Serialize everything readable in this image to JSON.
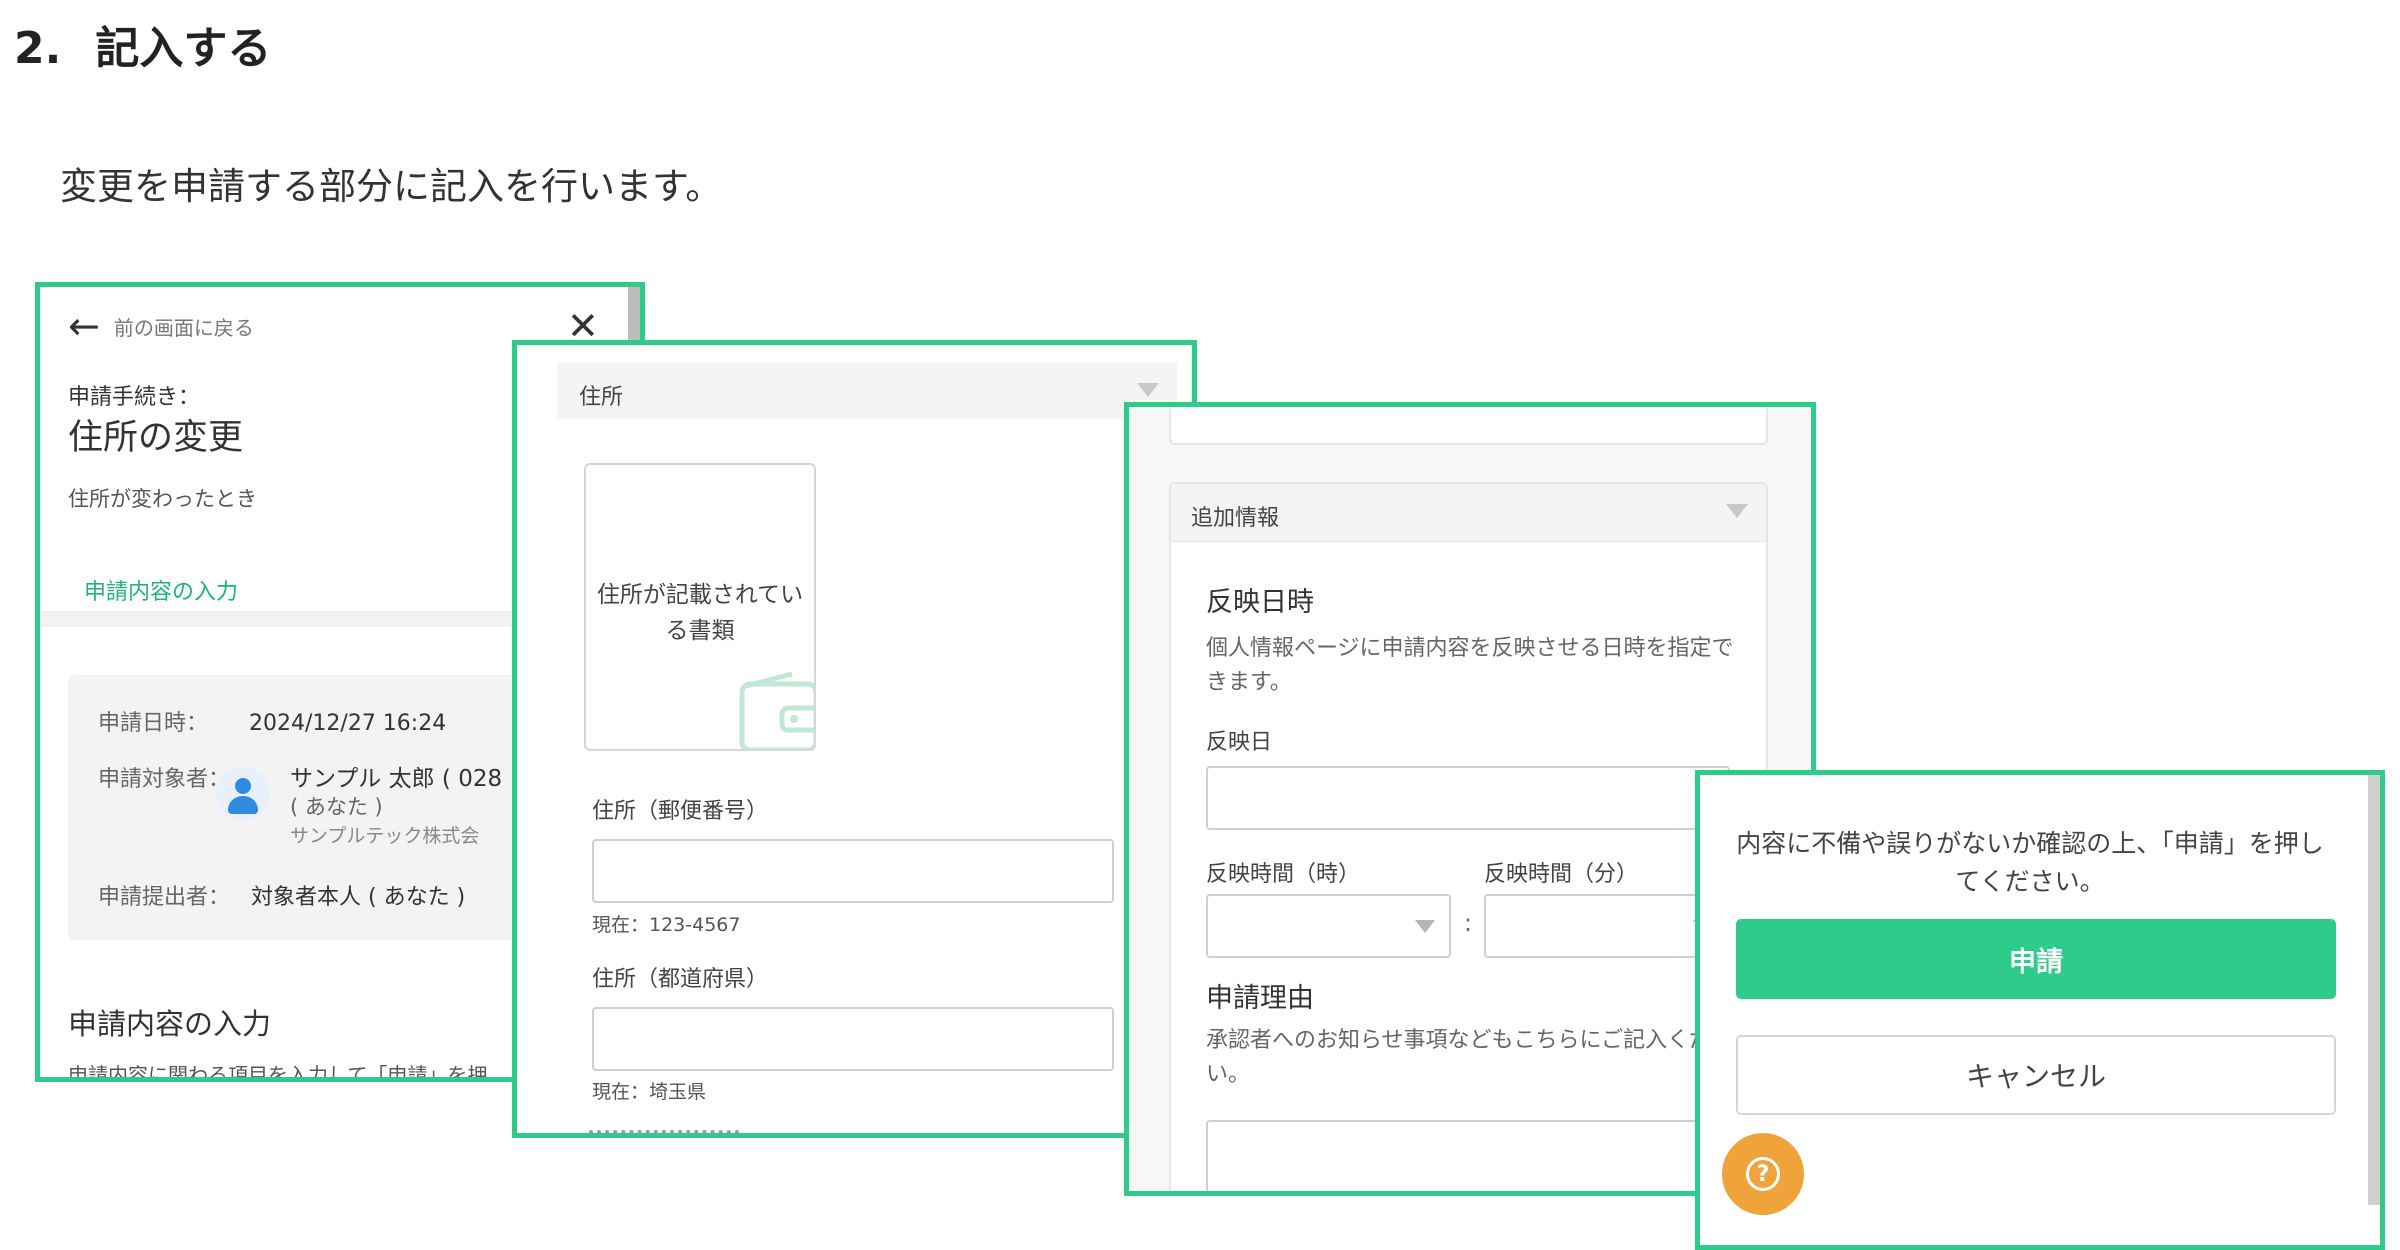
{
  "page": {
    "heading_number": "2.",
    "heading": "記入する",
    "intro": "変更を申請する部分に記入を行います。"
  },
  "panel1": {
    "back_label": "前の画面に戻る",
    "close_glyph": "✕",
    "procedure_label": "申請手続き：",
    "procedure_title": "住所の変更",
    "procedure_desc": "住所が変わったとき",
    "tab_label": "申請内容の入力",
    "info": {
      "date_label": "申請日時：",
      "date_value": "2024/12/27 16:24",
      "target_label": "申請対象者：",
      "target_name": "サンプル 太郎 ( 028",
      "target_you": "( あなた )",
      "target_company": "サンプルテック株式会",
      "submitter_label": "申請提出者：",
      "submitter_value": "対象者本人 ( あなた )"
    },
    "section_title": "申請内容の入力",
    "section_desc": "申請内容に関わる項目を入力して「申請」を押"
  },
  "panel2": {
    "header": "住所",
    "document_label_line1": "住所が記載されてい",
    "document_label_line2": "る書類",
    "postal_label": "住所（郵便番号）",
    "postal_value": "",
    "postal_current": "現在：123-4567",
    "prefecture_label": "住所（都道府県）",
    "prefecture_value": "",
    "prefecture_current": "現在：埼玉県"
  },
  "panel3": {
    "header": "追加情報",
    "reflect_title": "反映日時",
    "reflect_desc": "個人情報ページに申請内容を反映させる日時を指定できます。",
    "reflect_date_label": "反映日",
    "reflect_date_value": "",
    "reflect_hour_label": "反映時間（時）",
    "reflect_minute_label": "反映時間（分）",
    "time_separator": ":",
    "reason_title": "申請理由",
    "reason_desc": "承認者へのお知らせ事項などもこちらにご記入ください。",
    "reason_value": ""
  },
  "panel4": {
    "confirm_text": "内容に不備や誤りがないか確認の上、「申請」を押してください。",
    "submit_label": "申請",
    "cancel_label": "キャンセル",
    "help_glyph": "?"
  },
  "colors": {
    "accent": "#2ecc8b",
    "help": "#f0a33a"
  }
}
